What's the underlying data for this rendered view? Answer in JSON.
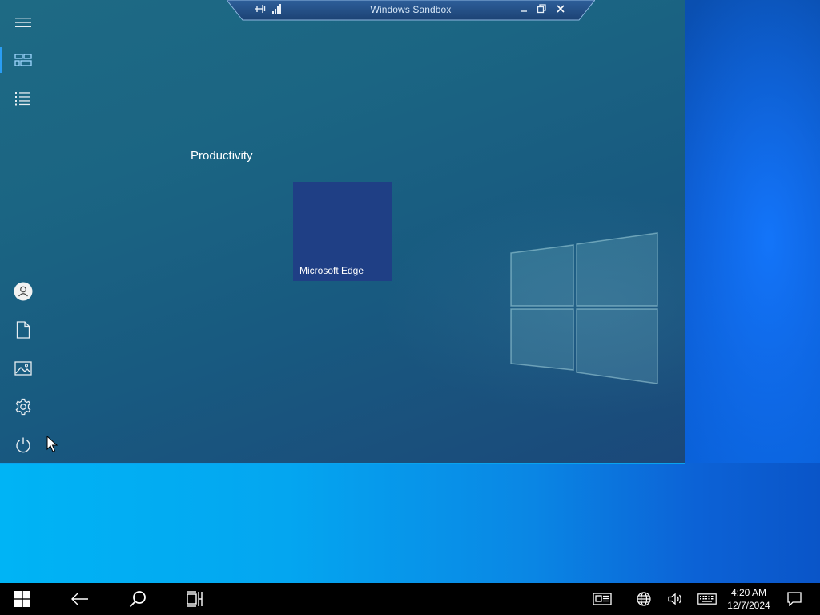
{
  "window": {
    "title": "Windows Sandbox"
  },
  "start_menu": {
    "group_title": "Productivity",
    "tiles": [
      {
        "label": "Microsoft Edge",
        "color": "#1f3f85"
      }
    ],
    "rail_top": [
      {
        "name": "hamburger-menu-icon",
        "active": false
      },
      {
        "name": "tiles-icon",
        "active": true
      },
      {
        "name": "all-apps-list-icon",
        "active": false
      }
    ],
    "rail_bottom": [
      {
        "name": "user-icon"
      },
      {
        "name": "documents-icon"
      },
      {
        "name": "pictures-icon"
      },
      {
        "name": "settings-gear-icon"
      },
      {
        "name": "power-icon"
      }
    ]
  },
  "taskbar": {
    "buttons": [
      "windows-start-icon",
      "back-arrow-icon",
      "search-icon",
      "task-view-icon"
    ],
    "tray": [
      "news-icon",
      "network-globe-icon",
      "volume-icon",
      "keyboard-icon"
    ],
    "clock": {
      "time": "4:20 AM",
      "date": "12/7/2024"
    },
    "action_center": "notification-icon"
  },
  "colors": {
    "accent": "#0aa3ee",
    "taskbar": "#000000",
    "start_menu": "#1b6583"
  }
}
